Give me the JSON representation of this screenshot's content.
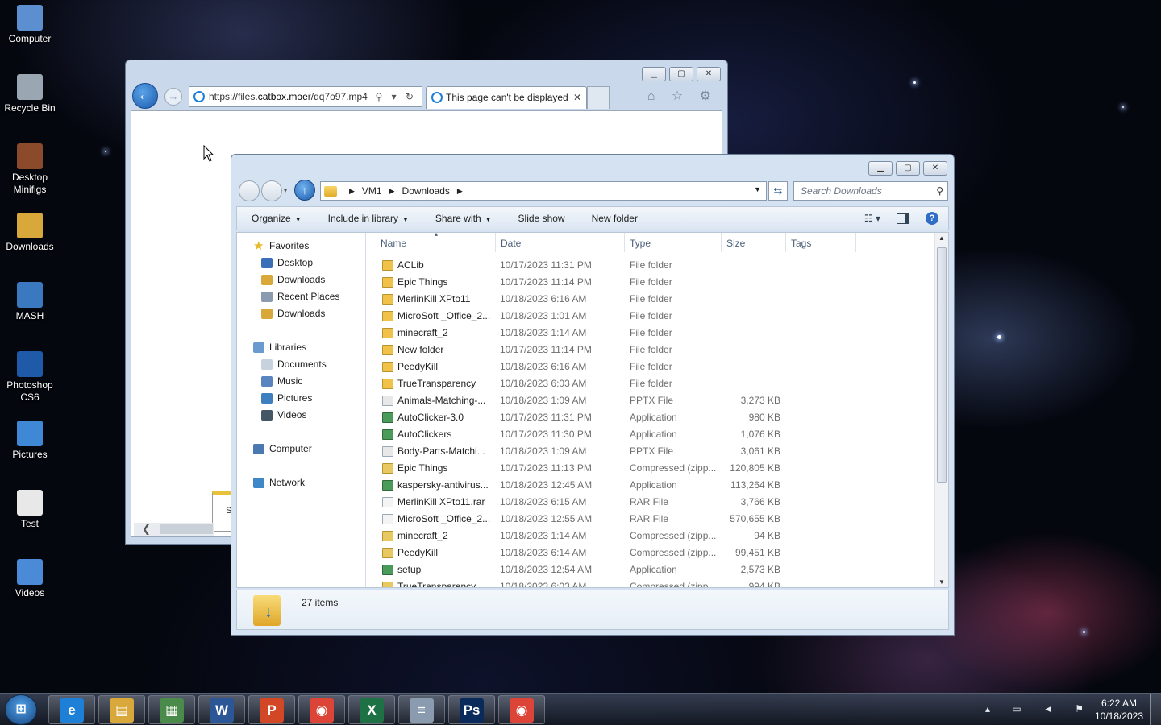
{
  "desktop": {
    "icons": [
      {
        "label_line1": "Computer",
        "label_line2": "",
        "icon": "computer-icon"
      },
      {
        "label_line1": "Recycle Bin",
        "label_line2": "",
        "icon": "recycle-bin-icon"
      },
      {
        "label_line1": "Desktop",
        "label_line2": "Minifigs",
        "icon": "minifig-icon"
      },
      {
        "label_line1": "Downloads",
        "label_line2": "",
        "icon": "downloads-shortcut-icon"
      },
      {
        "label_line1": "MASH",
        "label_line2": "",
        "icon": "mash-shortcut-icon"
      },
      {
        "label_line1": "Photoshop",
        "label_line2": "CS6",
        "icon": "photoshop-shortcut-icon"
      },
      {
        "label_line1": "Pictures",
        "label_line2": "",
        "icon": "pictures-shortcut-icon"
      },
      {
        "label_line1": "Test",
        "label_line2": "",
        "icon": "docx-file-icon"
      },
      {
        "label_line1": "Videos",
        "label_line2": "",
        "icon": "videos-shortcut-icon"
      }
    ]
  },
  "ie": {
    "url_prefix": "https://files.",
    "url_domain": "catbox.moe",
    "url_suffix": "r/dq7o97.mp4",
    "tab_title": "This page can't be displayed",
    "tab_close": "✕",
    "address_tools": "⚲ ▾ ↻",
    "toolbar_icons": "⌂ ☆ ⚙",
    "partial_char": "S"
  },
  "explorer": {
    "breadcrumb": [
      "VM1",
      "Downloads"
    ],
    "search_placeholder": "Search Downloads",
    "commands": [
      {
        "label": "Organize",
        "dropdown": true
      },
      {
        "label": "Include in library",
        "dropdown": true
      },
      {
        "label": "Share with",
        "dropdown": true
      },
      {
        "label": "Slide show",
        "dropdown": false
      },
      {
        "label": "New folder",
        "dropdown": false
      }
    ],
    "nav": {
      "favorites_label": "Favorites",
      "favorites": [
        "Desktop",
        "Downloads",
        "Recent Places",
        "Downloads"
      ],
      "libraries_label": "Libraries",
      "libraries": [
        "Documents",
        "Music",
        "Pictures",
        "Videos"
      ],
      "computer_label": "Computer",
      "network_label": "Network"
    },
    "columns": {
      "name": "Name",
      "date": "Date",
      "type": "Type",
      "size": "Size",
      "tags": "Tags"
    },
    "files": [
      {
        "name": "ACLib",
        "date": "10/17/2023 11:31 PM",
        "type": "File folder",
        "size": "",
        "kind": "folder"
      },
      {
        "name": "Epic Things",
        "date": "10/17/2023 11:14 PM",
        "type": "File folder",
        "size": "",
        "kind": "folder"
      },
      {
        "name": "MerlinKill XPto11",
        "date": "10/18/2023 6:16 AM",
        "type": "File folder",
        "size": "",
        "kind": "folder"
      },
      {
        "name": "MicroSoft _Office_2...",
        "date": "10/18/2023 1:01 AM",
        "type": "File folder",
        "size": "",
        "kind": "folder"
      },
      {
        "name": "minecraft_2",
        "date": "10/18/2023 1:14 AM",
        "type": "File folder",
        "size": "",
        "kind": "folder"
      },
      {
        "name": "New folder",
        "date": "10/17/2023 11:14 PM",
        "type": "File folder",
        "size": "",
        "kind": "folder"
      },
      {
        "name": "PeedyKill",
        "date": "10/18/2023 6:16 AM",
        "type": "File folder",
        "size": "",
        "kind": "folder"
      },
      {
        "name": "TrueTransparency",
        "date": "10/18/2023 6:03 AM",
        "type": "File folder",
        "size": "",
        "kind": "folder"
      },
      {
        "name": "Animals-Matching-...",
        "date": "10/18/2023 1:09 AM",
        "type": "PPTX File",
        "size": "3,273 KB",
        "kind": "pptx"
      },
      {
        "name": "AutoClicker-3.0",
        "date": "10/17/2023 11:31 PM",
        "type": "Application",
        "size": "980 KB",
        "kind": "app"
      },
      {
        "name": "AutoClickers",
        "date": "10/17/2023 11:30 PM",
        "type": "Application",
        "size": "1,076 KB",
        "kind": "app"
      },
      {
        "name": "Body-Parts-Matchi...",
        "date": "10/18/2023 1:09 AM",
        "type": "PPTX File",
        "size": "3,061 KB",
        "kind": "pptx"
      },
      {
        "name": "Epic Things",
        "date": "10/17/2023 11:13 PM",
        "type": "Compressed (zipp...",
        "size": "120,805 KB",
        "kind": "zip"
      },
      {
        "name": "kaspersky-antivirus...",
        "date": "10/18/2023 12:45 AM",
        "type": "Application",
        "size": "113,264 KB",
        "kind": "app"
      },
      {
        "name": "MerlinKill XPto11.rar",
        "date": "10/18/2023 6:15 AM",
        "type": "RAR File",
        "size": "3,766 KB",
        "kind": "rar"
      },
      {
        "name": "MicroSoft _Office_2...",
        "date": "10/18/2023 12:55 AM",
        "type": "RAR File",
        "size": "570,655 KB",
        "kind": "rar"
      },
      {
        "name": "minecraft_2",
        "date": "10/18/2023 1:14 AM",
        "type": "Compressed (zipp...",
        "size": "94 KB",
        "kind": "zip"
      },
      {
        "name": "PeedyKill",
        "date": "10/18/2023 6:14 AM",
        "type": "Compressed (zipp...",
        "size": "99,451 KB",
        "kind": "zip"
      },
      {
        "name": "setup",
        "date": "10/18/2023 12:54 AM",
        "type": "Application",
        "size": "2,573 KB",
        "kind": "app"
      },
      {
        "name": "TrueTransparency",
        "date": "10/18/2023 6:03 AM",
        "type": "Compressed (zipp...",
        "size": "994 KB",
        "kind": "zip"
      }
    ],
    "item_count": "27 items"
  },
  "taskbar": {
    "start_glyph": "⊞",
    "apps": [
      {
        "name": "internet-explorer",
        "glyph": "e",
        "color": "#1d7fd6"
      },
      {
        "name": "file-explorer",
        "glyph": "▤",
        "color": "#d9a83a"
      },
      {
        "name": "task-manager",
        "glyph": "▦",
        "color": "#4a8a4a"
      },
      {
        "name": "word",
        "glyph": "W",
        "color": "#2b5797"
      },
      {
        "name": "powerpoint",
        "glyph": "P",
        "color": "#d24726"
      },
      {
        "name": "chrome",
        "glyph": "◉",
        "color": "#db4437"
      },
      {
        "name": "excel",
        "glyph": "X",
        "color": "#1e7145"
      },
      {
        "name": "notepad",
        "glyph": "≡",
        "color": "#8a9bb0"
      },
      {
        "name": "photoshop",
        "glyph": "Ps",
        "color": "#0a2a5c"
      },
      {
        "name": "chrome-2",
        "glyph": "◉",
        "color": "#db4437"
      }
    ],
    "tray_icons": "▴ ▭ ◄ ⚑",
    "time": "6:22 AM",
    "date": "10/18/2023"
  }
}
